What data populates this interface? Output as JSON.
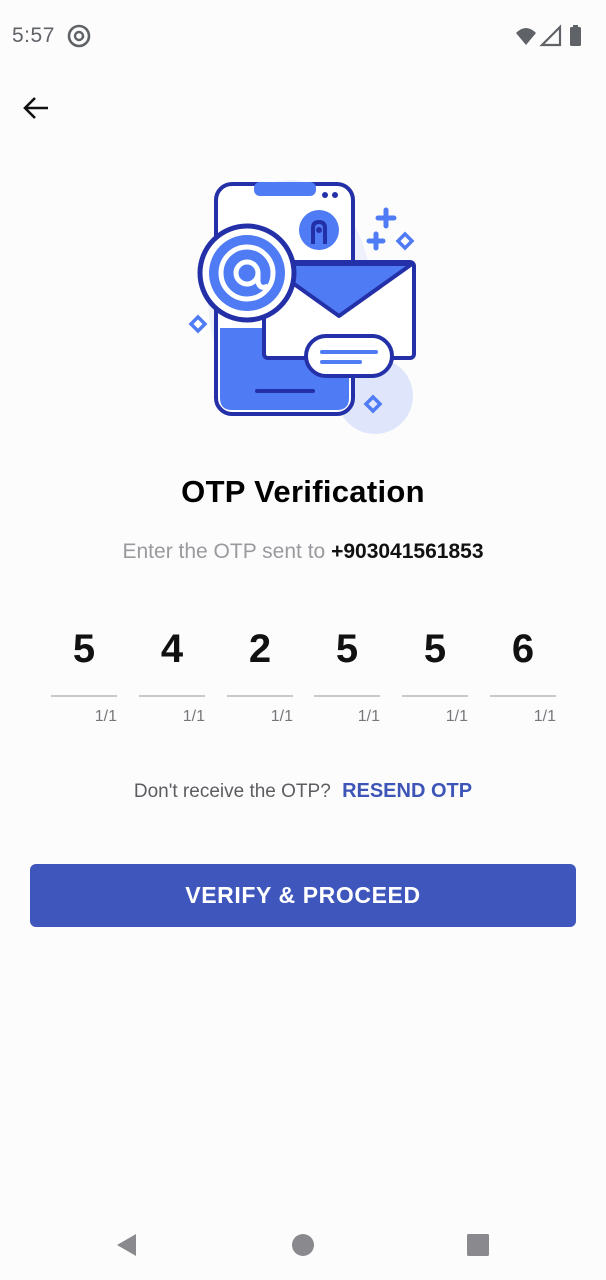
{
  "status_bar": {
    "time": "5:57",
    "app_icon": "at-sign-icon",
    "icons": [
      "wifi-icon",
      "signal-icon",
      "battery-icon"
    ]
  },
  "header": {
    "back_icon": "arrow-left-icon"
  },
  "illustration": {
    "icon": "otp-phone-email-illustration",
    "colors": {
      "primary": "#4f7cf5",
      "outline": "#2430a8",
      "light": "#dfe6fb"
    }
  },
  "main": {
    "title": "OTP Verification",
    "subtitle_prefix": "Enter the OTP sent to",
    "phone_number": "+903041561853",
    "otp": [
      {
        "digit": "5",
        "counter": "1/1"
      },
      {
        "digit": "4",
        "counter": "1/1"
      },
      {
        "digit": "2",
        "counter": "1/1"
      },
      {
        "digit": "5",
        "counter": "1/1"
      },
      {
        "digit": "5",
        "counter": "1/1"
      },
      {
        "digit": "6",
        "counter": "1/1"
      }
    ],
    "resend_prompt": "Don't receive the OTP?",
    "resend_label": "RESEND OTP",
    "verify_label": "VERIFY & PROCEED"
  },
  "nav_bar": {
    "icons": [
      "back-triangle-icon",
      "home-circle-icon",
      "recents-square-icon"
    ]
  },
  "colors": {
    "accent": "#3f57bd",
    "link": "#3e55b8",
    "muted": "#9a9a9e"
  }
}
